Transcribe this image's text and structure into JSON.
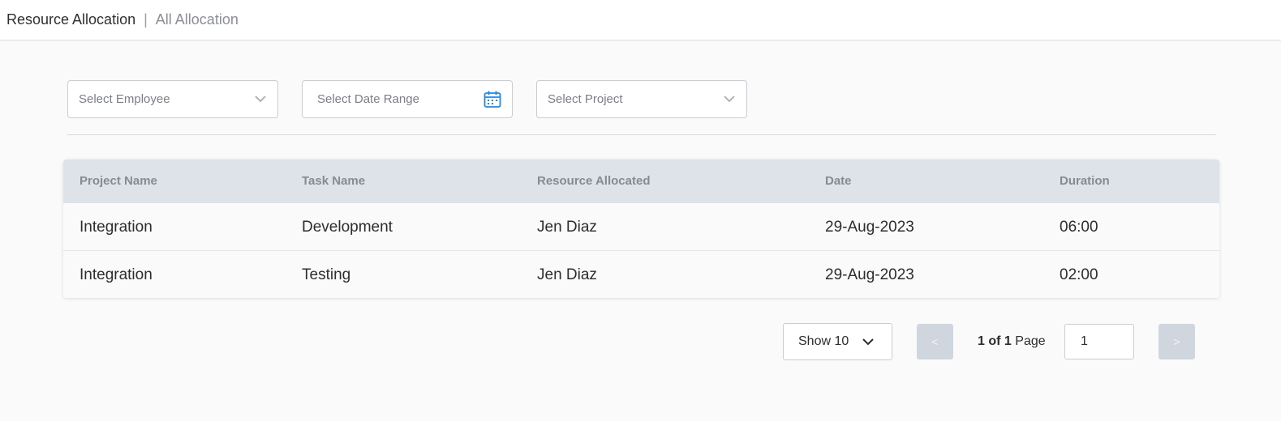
{
  "breadcrumb": {
    "main": "Resource Allocation",
    "separator": "|",
    "sub": "All Allocation"
  },
  "filters": {
    "employee_placeholder": "Select Employee",
    "date_range_placeholder": "Select Date Range",
    "project_placeholder": "Select Project"
  },
  "table": {
    "headers": {
      "project": "Project Name",
      "task": "Task Name",
      "resource": "Resource Allocated",
      "date": "Date",
      "duration": "Duration"
    },
    "rows": [
      {
        "project": "Integration",
        "task": "Development",
        "resource": "Jen Diaz",
        "date": "29-Aug-2023",
        "duration": "06:00"
      },
      {
        "project": "Integration",
        "task": "Testing",
        "resource": "Jen Diaz",
        "date": "29-Aug-2023",
        "duration": "02:00"
      }
    ]
  },
  "pagination": {
    "show_label": "Show 10",
    "prev_label": "<",
    "next_label": ">",
    "current": "1",
    "of_word": "of",
    "total": "1",
    "page_word": "Page",
    "page_input_value": "1"
  },
  "colors": {
    "accent": "#1e88e5",
    "header_bg": "#dee3ea",
    "button_disabled": "#cfd6de"
  },
  "icons": {
    "employee_dropdown": "chevron-down-icon",
    "date_picker": "calendar-icon",
    "project_dropdown": "chevron-down-icon",
    "show_dropdown": "chevron-down-icon"
  }
}
